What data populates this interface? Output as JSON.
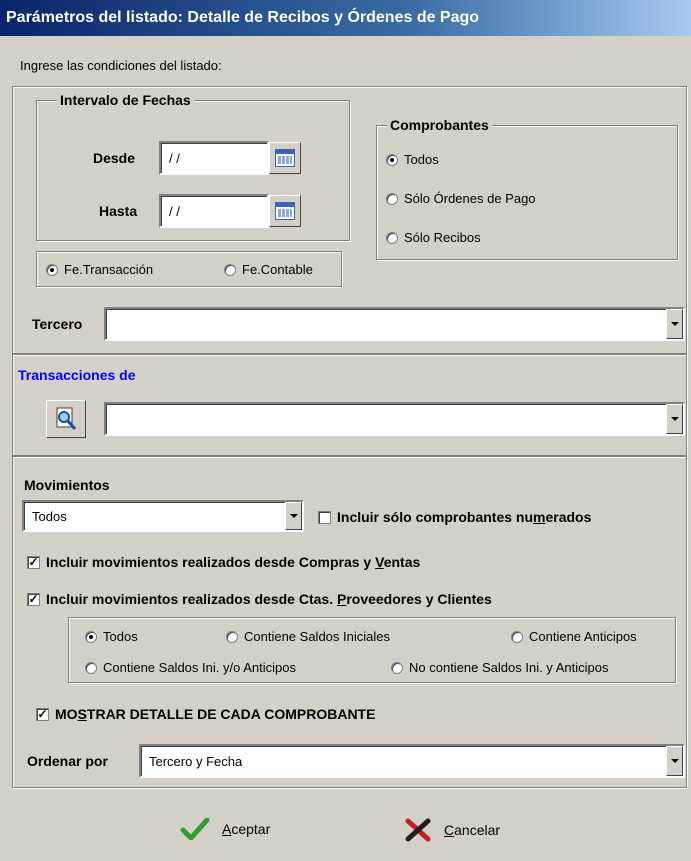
{
  "window": {
    "title": "Parámetros del listado: Detalle de Recibos y Órdenes de Pago"
  },
  "prompt": "Ingrese las condiciones del listado:",
  "fechas": {
    "legend": "Intervalo de Fechas",
    "desde_label": "Desde",
    "desde_value": "/ /",
    "hasta_label": "Hasta",
    "hasta_value": "/ /",
    "tipo_options": [
      "Fe.Transacción",
      "Fe.Contable"
    ],
    "tipo_selected": "Fe.Transacción"
  },
  "comprobantes": {
    "legend": "Comprobantes",
    "options": [
      "Todos",
      "Sólo Órdenes de Pago",
      "Sólo Recibos"
    ],
    "selected": "Todos"
  },
  "tercero": {
    "label": "Tercero",
    "value": ""
  },
  "transacciones": {
    "title": "Transacciones de",
    "value": ""
  },
  "movimientos": {
    "label": "Movimientos",
    "value": "Todos",
    "solo_numerados_label": "Incluir sólo comprobantes numerados",
    "solo_numerados_checked": false,
    "compras_ventas_label": "Incluir movimientos realizados desde Compras y Ventas",
    "compras_ventas_checked": true,
    "ctas_label": "Incluir movimientos realizados desde Ctas. Proveedores y Clientes",
    "ctas_checked": true,
    "filter_options": [
      "Todos",
      "Contiene Saldos Iniciales",
      "Contiene Anticipos",
      "Contiene Saldos Ini. y/o Anticipos",
      "No contiene Saldos Ini. y Anticipos"
    ],
    "filter_selected": "Todos"
  },
  "detalle": {
    "label": "MOSTRAR DETALLE DE CADA COMPROBANTE",
    "checked": true
  },
  "orden": {
    "label": "Ordenar por",
    "value": "Tercero y Fecha"
  },
  "actions": {
    "accept": "Aceptar",
    "cancel": "Cancelar"
  },
  "colors": {
    "title_bar": "#0a246a",
    "section_title": "#0000ff",
    "accept_icon": "#2e9e2e",
    "cancel_icon": "#c81e1e",
    "background": "#d4d0c8"
  }
}
